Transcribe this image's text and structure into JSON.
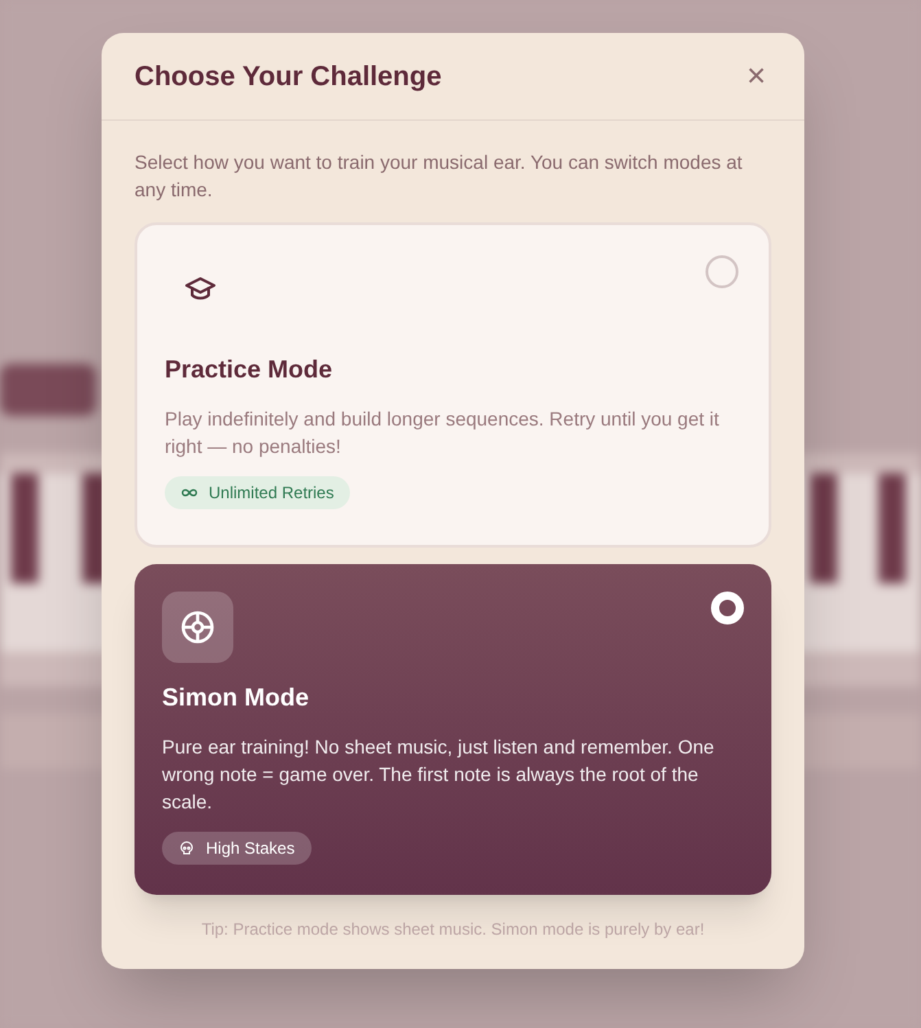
{
  "dialog": {
    "title": "Choose Your Challenge",
    "close": "×",
    "intro": "Select how you want to train your musical ear. You can switch modes at any time.",
    "modes": [
      {
        "kind": "practice",
        "title": "Practice Mode",
        "description": "Play indefinitely and build longer sequences. Retry until you get it right — no penalties!",
        "badge": "Unlimited Retries",
        "selected": false
      },
      {
        "kind": "simon",
        "title": "Simon Mode",
        "description": "Pure ear training! No sheet music, just listen and remember. One wrong note = game over. The first note is always the root of the scale.",
        "badge": "High Stakes",
        "selected": true
      }
    ],
    "tip": "Tip: Practice mode shows sheet music. Simon mode is purely by ear!"
  }
}
